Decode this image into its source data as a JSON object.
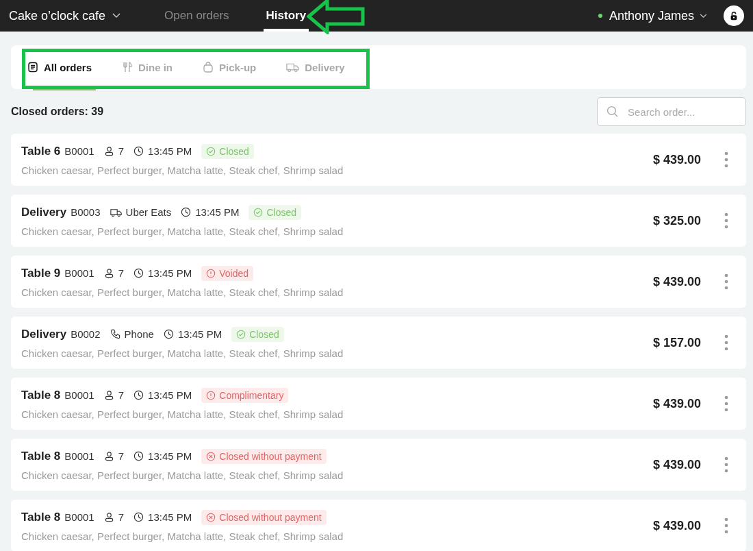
{
  "header": {
    "venue": "Cake o’clock cafe",
    "nav": [
      {
        "label": "Open orders",
        "selected": false
      },
      {
        "label": "History",
        "selected": true
      }
    ],
    "user": {
      "name": "Anthony James",
      "online": true
    }
  },
  "filters": [
    {
      "kind": "list",
      "label": "All orders",
      "selected": true
    },
    {
      "kind": "dine",
      "label": "Dine in",
      "selected": false
    },
    {
      "kind": "pickup",
      "label": "Pick-up",
      "selected": false
    },
    {
      "kind": "delivery",
      "label": "Delivery",
      "selected": false
    }
  ],
  "summary": "Closed orders: 39",
  "search": {
    "placeholder": "Search order..."
  },
  "orders": [
    {
      "title": "Table 6",
      "code": "B0001",
      "meta": {
        "kind": "guests",
        "text": "7"
      },
      "time": "13:45 PM",
      "status": {
        "kind": "ok",
        "label": "Closed"
      },
      "items": "Chicken caesar, Perfect burger, Matcha latte, Steak chef, Shrimp salad",
      "total": "$ 439.00"
    },
    {
      "title": "Delivery",
      "code": "B0003",
      "meta": {
        "kind": "courier",
        "text": "Uber Eats"
      },
      "time": "13:45 PM",
      "status": {
        "kind": "ok",
        "label": "Closed"
      },
      "items": "Chicken caesar, Perfect burger, Matcha latte, Steak chef, Shrimp salad",
      "total": "$ 325.00"
    },
    {
      "title": "Table 9",
      "code": "B0001",
      "meta": {
        "kind": "guests",
        "text": "7"
      },
      "time": "13:45 PM",
      "status": {
        "kind": "alert",
        "label": "Voided"
      },
      "items": "Chicken caesar, Perfect burger, Matcha latte, Steak chef, Shrimp salad",
      "total": "$ 439.00"
    },
    {
      "title": "Delivery",
      "code": "B0002",
      "meta": {
        "kind": "phone",
        "text": "Phone"
      },
      "time": "13:45 PM",
      "status": {
        "kind": "ok",
        "label": "Closed"
      },
      "items": "Chicken caesar, Perfect burger, Matcha latte, Steak chef, Shrimp salad",
      "total": "$ 157.00"
    },
    {
      "title": "Table 8",
      "code": "B0001",
      "meta": {
        "kind": "guests",
        "text": "7"
      },
      "time": "13:45 PM",
      "status": {
        "kind": "alert",
        "label": "Complimentary"
      },
      "items": "Chicken caesar, Perfect burger, Matcha latte, Steak chef, Shrimp salad",
      "total": "$ 439.00"
    },
    {
      "title": "Table 8",
      "code": "B0001",
      "meta": {
        "kind": "guests",
        "text": "7"
      },
      "time": "13:45 PM",
      "status": {
        "kind": "cancel",
        "label": "Closed without payment"
      },
      "items": "Chicken caesar, Perfect burger, Matcha latte, Steak chef, Shrimp salad",
      "total": "$ 439.00"
    },
    {
      "title": "Table 8",
      "code": "B0001",
      "meta": {
        "kind": "guests",
        "text": "7"
      },
      "time": "13:45 PM",
      "status": {
        "kind": "cancel",
        "label": "Closed without payment"
      },
      "items": "Chicken caesar, Perfect burger, Matcha latte, Steak chef, Shrimp salad",
      "total": "$ 439.00"
    }
  ]
}
